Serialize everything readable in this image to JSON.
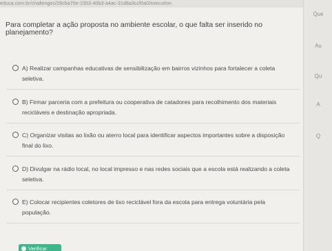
{
  "browser": {
    "url": "educa.com.br/challenges/28cba70e-2353-40b3-a4ac-31d8a3ccf0a0/execution"
  },
  "side_panel": {
    "items": [
      "Que",
      "Au",
      "Qu",
      "A",
      "Q"
    ]
  },
  "question": {
    "text": "Para completar a ação proposta no ambiente escolar, o que falta ser inserido no planejamento?"
  },
  "options": [
    {
      "label": "A) Realizar campanhas educativas de sensibilização em bairros vizinhos para fortalecer a coleta seletiva.",
      "selected": false
    },
    {
      "label": "B) Firmar parceria com a prefeitura ou cooperativa de catadores para recolhimento dos materiais recicláveis e destinação apropriada.",
      "selected": false
    },
    {
      "label": "C) Organizar visitas ao lixão ou aterro local para identificar aspectos importantes sobre a disposição final do lixo.",
      "selected": false
    },
    {
      "label": "D) Divulgar na rádio local, no local impresso e nas redes sociais que a escola está realizando a coleta seletiva.",
      "selected": false
    },
    {
      "label": "E) Colocar recipientes coletores de lixo reciclável fora da escola para entrega voluntária pela população.",
      "selected": false
    }
  ],
  "actions": {
    "verify_label": "Verificar"
  },
  "colors": {
    "accent": "#3fb58c",
    "background": "#f1f0ec",
    "text": "#3f3f3f"
  }
}
